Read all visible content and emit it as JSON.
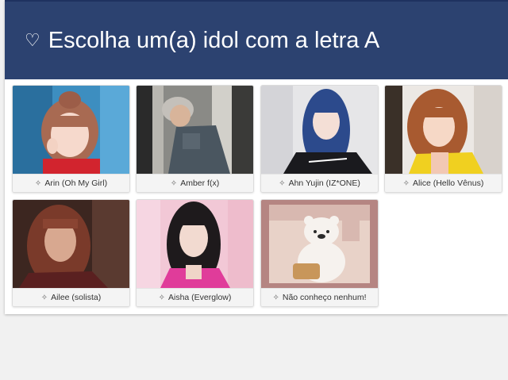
{
  "header": {
    "icon": "heart-outline-icon",
    "title": "Escolha um(a) idol com a letra A"
  },
  "options": [
    {
      "label": "Arin (Oh My Girl)",
      "icon": "sparkle-icon"
    },
    {
      "label": "Amber f(x)",
      "icon": "sparkle-icon"
    },
    {
      "label": "Ahn Yujin (IZ*ONE)",
      "icon": "sparkle-icon"
    },
    {
      "label": "Alice (Hello Vênus)",
      "icon": "sparkle-icon"
    },
    {
      "label": "Ailee (solista)",
      "icon": "sparkle-icon"
    },
    {
      "label": "Aisha (Everglow)",
      "icon": "sparkle-icon"
    },
    {
      "label": "Não conheço nenhum!",
      "icon": "sparkle-icon"
    }
  ],
  "colors": {
    "header_bg": "#2c4270",
    "page_bg": "#f1f1f1"
  }
}
